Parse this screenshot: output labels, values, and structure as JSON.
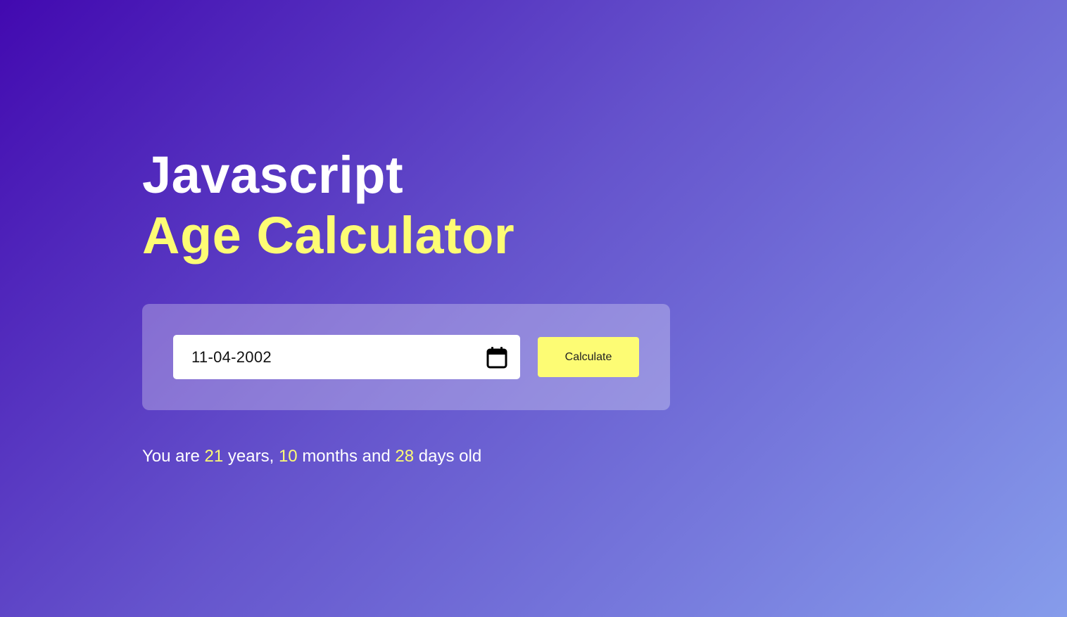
{
  "heading": {
    "line1": "Javascript",
    "line2": "Age Calculator"
  },
  "form": {
    "date_value": "11-04-2002",
    "calendar_icon": "calendar-icon",
    "button_label": "Calculate"
  },
  "result": {
    "prefix": "You are",
    "years": "21",
    "years_label": "years,",
    "months": "10",
    "months_label": "months and",
    "days": "28",
    "days_label": "days old"
  },
  "colors": {
    "accent": "#fdfc74",
    "gradient_start": "#4209b0",
    "gradient_end": "#869ceb",
    "text": "#ffffff"
  }
}
